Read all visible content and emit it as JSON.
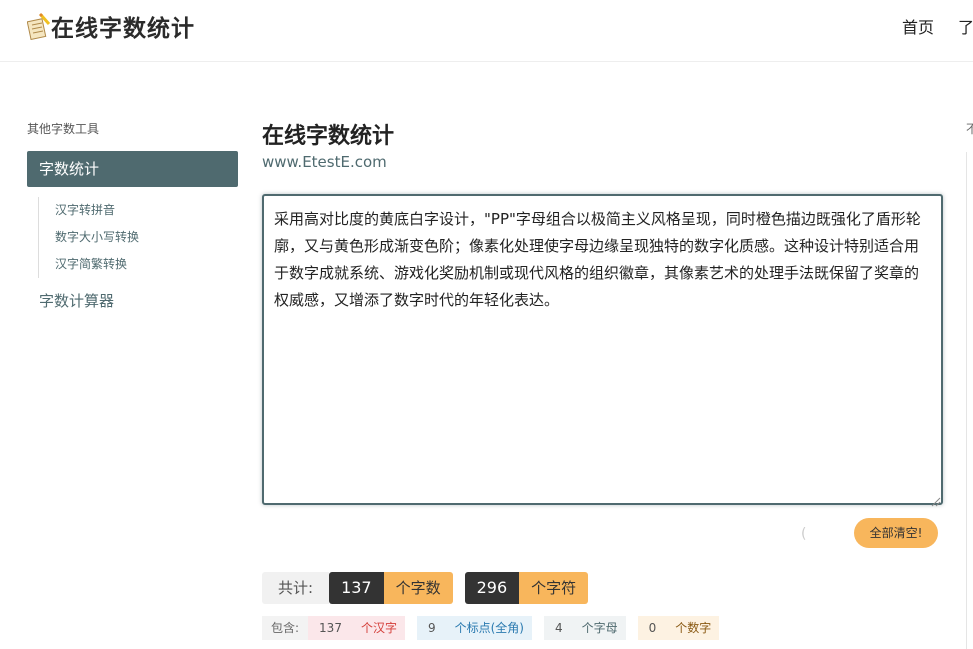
{
  "header": {
    "logo_text": "在线字数统计",
    "logo_icon": "pencil-notepad-icon",
    "nav": [
      "首页",
      "了"
    ]
  },
  "sidebar": {
    "heading": "其他字数工具",
    "active_item": "字数统计",
    "sub_items": [
      "汉字转拼音",
      "数字大小写转换",
      "汉字简繁转换"
    ],
    "item2": "字数计算器"
  },
  "main": {
    "title": "在线字数统计",
    "subtitle": "www.EtestE.com",
    "text": "采用高对比度的黄底白字设计，\"PP\"字母组合以极简主义风格呈现，同时橙色描边既强化了盾形轮廓，又与黄色形成渐变色阶；像素化处理使字母边缘呈现独特的数字化质感。这种设计特别适合用于数字成就系统、游戏化奖励机制或现代风格的组织徽章，其像素艺术的处理手法既保留了奖章的权威感，又增添了数字时代的年轻化表达。",
    "loader": "(",
    "clear_button": "全部清空!",
    "totals": {
      "label": "共计:",
      "chars_num": "137",
      "chars_unit": "个字数",
      "symbols_num": "296",
      "symbols_unit": "个字符"
    },
    "breakdown": {
      "label": "包含:",
      "hanzi_num": "137",
      "hanzi_unit": "个汉字",
      "punct_num": "9",
      "punct_unit": "个标点(全角)",
      "letters_num": "4",
      "letters_unit": "个字母",
      "digits_num": "0",
      "digits_unit": "个数字"
    }
  },
  "right_edge_text": "不",
  "colors": {
    "accent": "#4f6a6f",
    "orange": "#f8b65c",
    "dark": "#333333"
  }
}
